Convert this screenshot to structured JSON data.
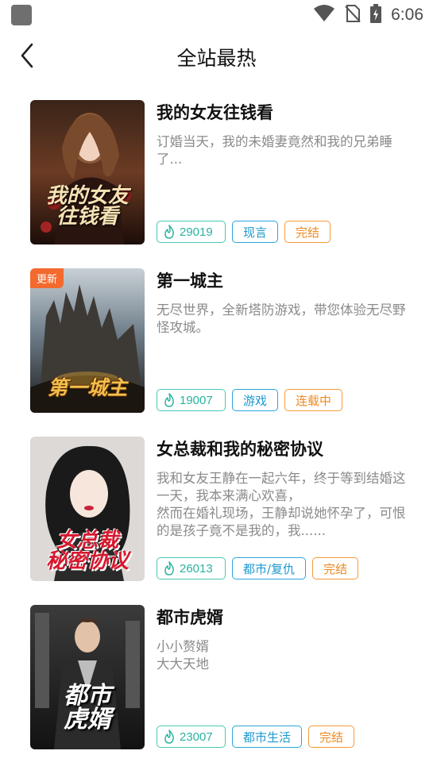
{
  "status_bar": {
    "time": "6:06",
    "icons": [
      "wifi-icon",
      "no-sim-icon",
      "battery-charging-icon"
    ]
  },
  "header": {
    "back_icon": "chevron-left-icon",
    "title": "全站最热"
  },
  "books": [
    {
      "title": "我的女友往钱看",
      "description": "订婚当天，我的未婚妻竟然和我的兄弟睡了...",
      "heat": "29019",
      "genre": "现言",
      "status": "完结",
      "badge": "",
      "cover_title": "我的女友\n往钱看"
    },
    {
      "title": "第一城主",
      "description": "无尽世界，全新塔防游戏，带您体验无尽野怪攻城。",
      "heat": "19007",
      "genre": "游戏",
      "status": "连载中",
      "badge": "更新",
      "cover_title": "第一城主"
    },
    {
      "title": "女总裁和我的秘密协议",
      "description": "我和女友王静在一起六年，终于等到结婚这一天，我本来满心欢喜，\n然而在婚礼现场，王静却说她怀孕了，可恨的是孩子竟不是我的，我......",
      "heat": "26013",
      "genre": "都市/复仇",
      "status": "完结",
      "badge": "",
      "cover_title": "女总裁\n秘密协议"
    },
    {
      "title": "都市虎婿",
      "description": "小小赘婿\n大大天地",
      "heat": "23007",
      "genre": "都市生活",
      "status": "完结",
      "badge": "",
      "cover_title": "都市\n虎婿"
    }
  ],
  "colors": {
    "heat": "#2ab39f",
    "genre": "#1d98cf",
    "status": "#ee8a23",
    "badge": "#f26a2e"
  }
}
